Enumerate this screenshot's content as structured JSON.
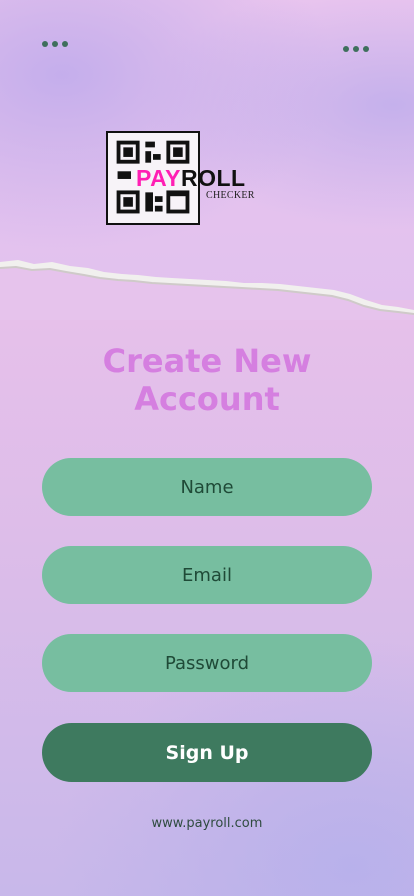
{
  "header": {
    "left_menu_icon": "more-dots-icon",
    "right_menu_icon": "more-dots-icon"
  },
  "logo": {
    "brand_pay": "PAY",
    "brand_roll": "ROLL",
    "subtitle": "CHECKER",
    "pay_color": "#ff1fb4"
  },
  "form": {
    "title_line1": "Create New",
    "title_line2": "Account",
    "name_placeholder": "Name",
    "email_placeholder": "Email",
    "password_placeholder": "Password",
    "signup_label": "Sign Up"
  },
  "footer": {
    "website": "www.payroll.com"
  },
  "colors": {
    "title": "#d57fe0",
    "field_bg": "#77bea0",
    "button_bg": "#3e7a5f",
    "dots": "#3f6f5c"
  }
}
